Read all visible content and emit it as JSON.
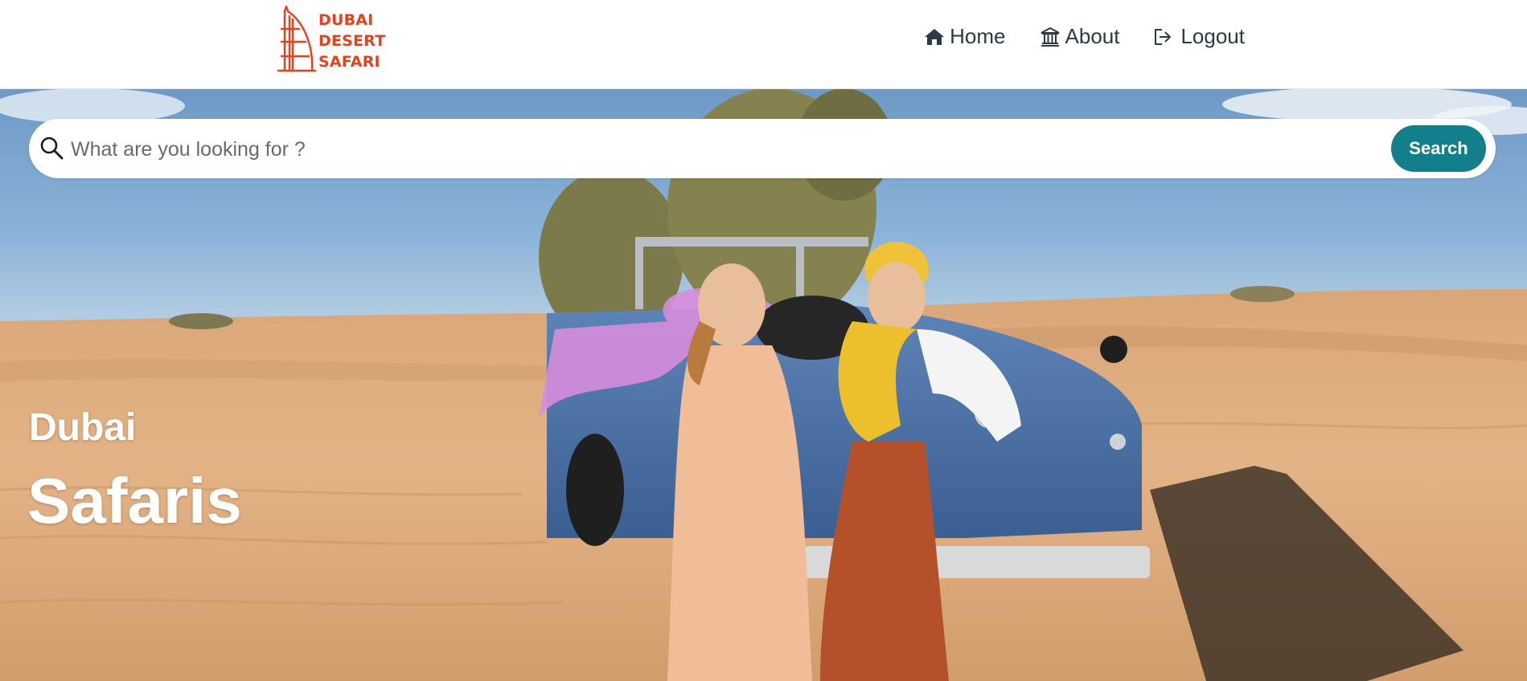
{
  "brand": {
    "lines": [
      "DUBAI",
      "DESERT",
      "SAFARI"
    ],
    "color": "#e8401c"
  },
  "nav": [
    {
      "label": "Home",
      "icon": "home-icon"
    },
    {
      "label": "About",
      "icon": "bank-icon"
    },
    {
      "label": "Logout",
      "icon": "logout-icon"
    }
  ],
  "search": {
    "placeholder": "What are you looking for ?",
    "value": "",
    "button_label": "Search",
    "button_color": "#137f8a"
  },
  "hero": {
    "subtitle": "Dubai",
    "title": "Safaris",
    "image_description_icon": "desert-safari-photo"
  }
}
